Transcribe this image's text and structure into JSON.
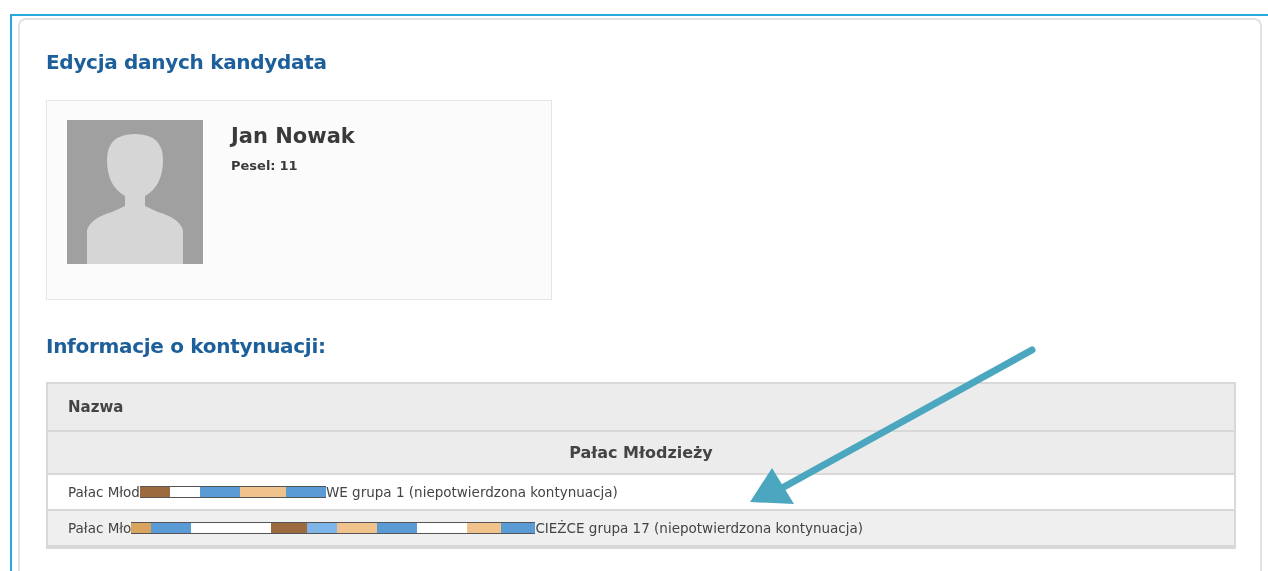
{
  "title": "Edycja danych kandydata",
  "candidate": {
    "name": "Jan Nowak",
    "pesel_label": "Pesel:",
    "pesel_value": "11"
  },
  "section_title": "Informacje o kontynuacji:",
  "table": {
    "columns": [
      "Nazwa"
    ],
    "group": "Pałac Młodzieży",
    "rows": [
      {
        "prefix": "Pałac Młod",
        "suffix": "WE grupa 1 (niepotwierdzona kontynuacja)",
        "highlighted": true
      },
      {
        "prefix": "Pałac Mło",
        "suffix": "CIEŻCE grupa 17 (niepotwierdzona kontynuacja)",
        "highlighted": false
      }
    ]
  }
}
